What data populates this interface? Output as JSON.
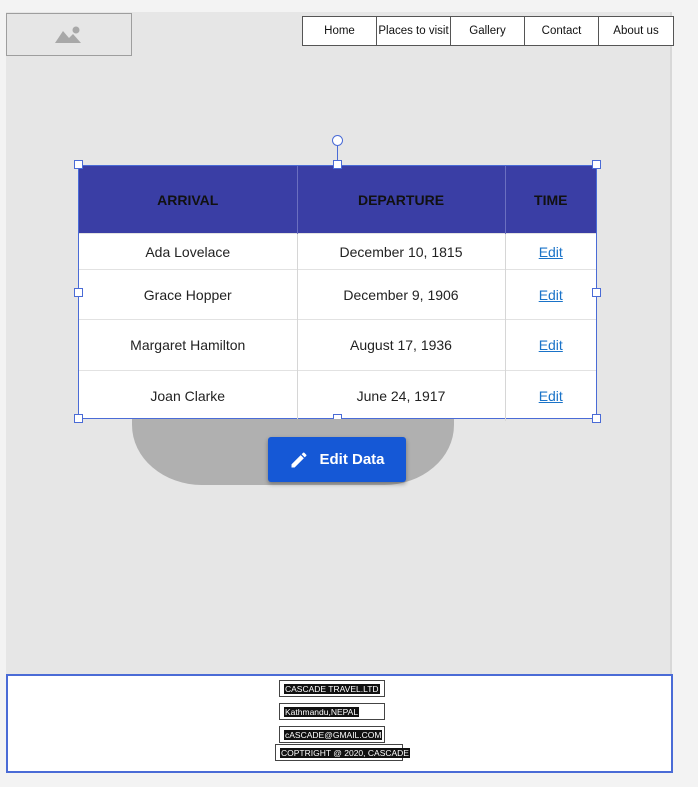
{
  "nav": {
    "items": [
      {
        "label": "Home"
      },
      {
        "label": "Places to visit"
      },
      {
        "label": "Gallery"
      },
      {
        "label": "Contact"
      },
      {
        "label": "About us"
      }
    ]
  },
  "table": {
    "headers": [
      "ARRIVAL",
      "DEPARTURE",
      "TIME"
    ],
    "rows": [
      {
        "arrival": "Ada Lovelace",
        "departure": "December 10, 1815",
        "time": "Edit"
      },
      {
        "arrival": "Grace Hopper",
        "departure": "December 9, 1906",
        "time": "Edit"
      },
      {
        "arrival": "Margaret Hamilton",
        "departure": "August 17, 1936",
        "time": "Edit"
      },
      {
        "arrival": "Joan Clarke",
        "departure": "June 24, 1917",
        "time": "Edit"
      }
    ]
  },
  "edit_button": {
    "label": "Edit Data"
  },
  "footer": {
    "company": "CASCADE TRAVEL.LTD",
    "location": "Kathmandu,NEPAL",
    "email": "cASCADE@GMAIL.COM",
    "copyright": "COPTRIGHT @ 2020, CASCADE"
  },
  "colors": {
    "table_header": "#3a3ea5",
    "button": "#1558d6",
    "selection": "#4a6bd6"
  }
}
